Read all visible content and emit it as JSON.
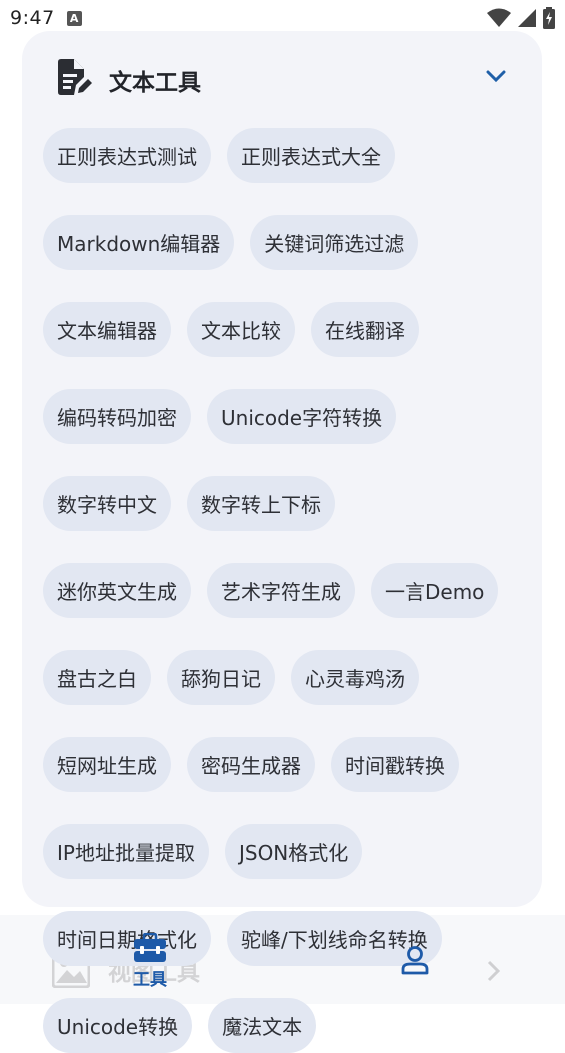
{
  "status_bar": {
    "time": "9:47",
    "notification_icon_letter": "A",
    "icons": [
      "wifi-icon",
      "signal-icon",
      "battery-charging-icon"
    ]
  },
  "card": {
    "title": "文本工具",
    "header_icon": "document-edit-icon",
    "collapse_icon": "chevron-down-icon",
    "accent_color": "#1f5fa8",
    "chips": [
      "正则表达式测试",
      "正则表达式大全",
      "Markdown编辑器",
      "关键词筛选过滤",
      "文本编辑器",
      "文本比较",
      "在线翻译",
      "编码转码加密",
      "Unicode字符转换",
      "数字转中文",
      "数字转上下标",
      "迷你英文生成",
      "艺术字符生成",
      "一言Demo",
      "盘古之白",
      "舔狗日记",
      "心灵毒鸡汤",
      "短网址生成",
      "密码生成器",
      "时间戳转换",
      "IP地址批量提取",
      "JSON格式化",
      "时间日期格式化",
      "驼峰/下划线命名转换",
      "Unicode转换",
      "魔法文本"
    ]
  },
  "behind_card": {
    "label": "视图工具",
    "icon": "image-icon"
  },
  "bottom_nav": {
    "tools_label": "工具",
    "tools_icon": "toolbox-icon",
    "user_icon": "user-icon",
    "active_color": "#1e5aa8"
  }
}
